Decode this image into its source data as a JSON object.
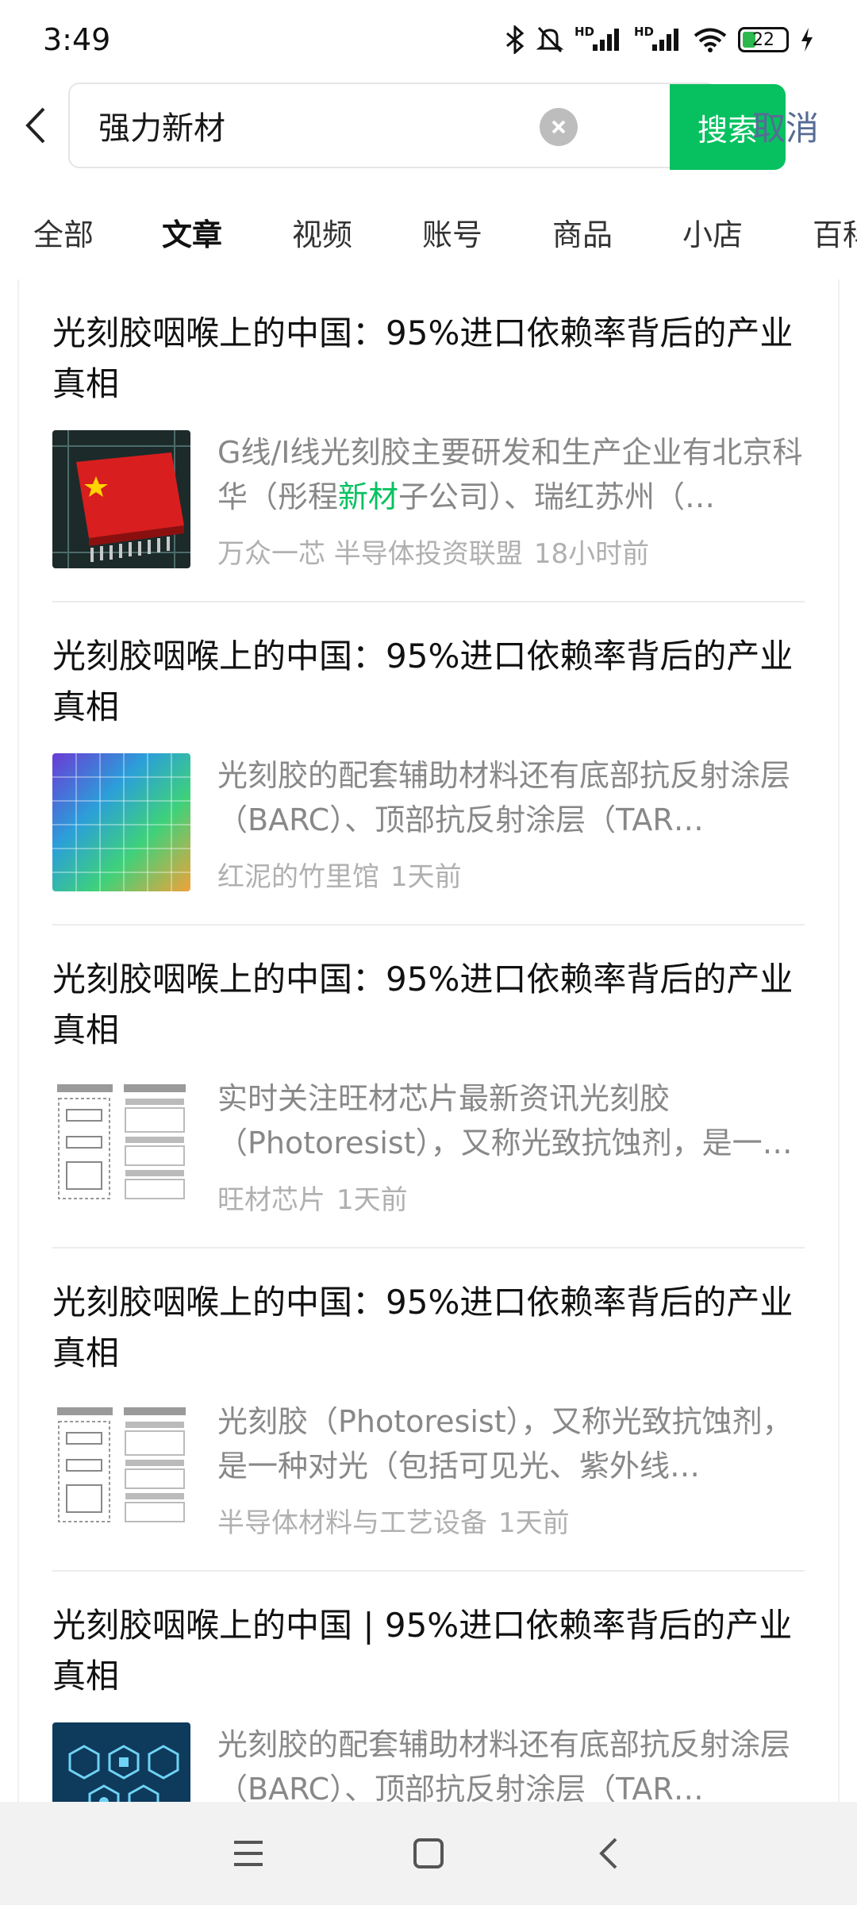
{
  "status": {
    "time": "3:49",
    "battery": "22"
  },
  "search": {
    "query": "强力新材",
    "button": "搜索",
    "cancel": "取消"
  },
  "tabs": [
    "全部",
    "文章",
    "视频",
    "账号",
    "商品",
    "小店",
    "百科"
  ],
  "active_tab": "文章",
  "articles": [
    {
      "title": "光刻胶咽喉上的中国：95%进口依赖率背后的产业真相",
      "snippet_before": "G线/I线光刻胶主要研发和生产企业有北京科华（彤程",
      "snippet_highlight": "新材",
      "snippet_after": "子公司）、瑞红苏州（…",
      "source": "万众一芯 半导体投资联盟",
      "time": "18小时前",
      "thumb": "chip-flag-thumbnail"
    },
    {
      "title": "光刻胶咽喉上的中国：95%进口依赖率背后的产业真相",
      "snippet_before": "光刻胶的配套辅助材料还有底部抗反射涂层（BARC）、顶部抗反射涂层（TAR…",
      "snippet_highlight": "",
      "snippet_after": "",
      "source": "红泥的竹里馆",
      "time": "1天前",
      "thumb": "wafer-thumbnail"
    },
    {
      "title": "光刻胶咽喉上的中国：95%进口依赖率背后的产业真相",
      "snippet_before": "实时关注旺材芯片最新资讯光刻胶（Photoresist），又称光致抗蚀剂，是一种对…",
      "snippet_highlight": "",
      "snippet_after": "",
      "source": "旺材芯片",
      "time": "1天前",
      "thumb": "diagram-thumbnail"
    },
    {
      "title": "光刻胶咽喉上的中国：95%进口依赖率背后的产业真相",
      "snippet_before": "光刻胶（Photoresist），又称光致抗蚀剂，是一种对光（包括可见光、紫外线…",
      "snippet_highlight": "",
      "snippet_after": "",
      "source": "半导体材料与工艺设备",
      "time": "1天前",
      "thumb": "diagram-thumbnail"
    },
    {
      "title": "光刻胶咽喉上的中国 | 95%进口依赖率背后的产业真相",
      "snippet_before": "光刻胶的配套辅助材料还有底部抗反射涂层（BARC）、顶部抗反射涂层（TAR…",
      "snippet_highlight": "",
      "snippet_after": "",
      "source": "",
      "time": "",
      "thumb": "tech-icons-thumbnail"
    }
  ],
  "colors": {
    "accent": "#07c160",
    "cancel": "#576b95",
    "highlight": "#07c160"
  }
}
